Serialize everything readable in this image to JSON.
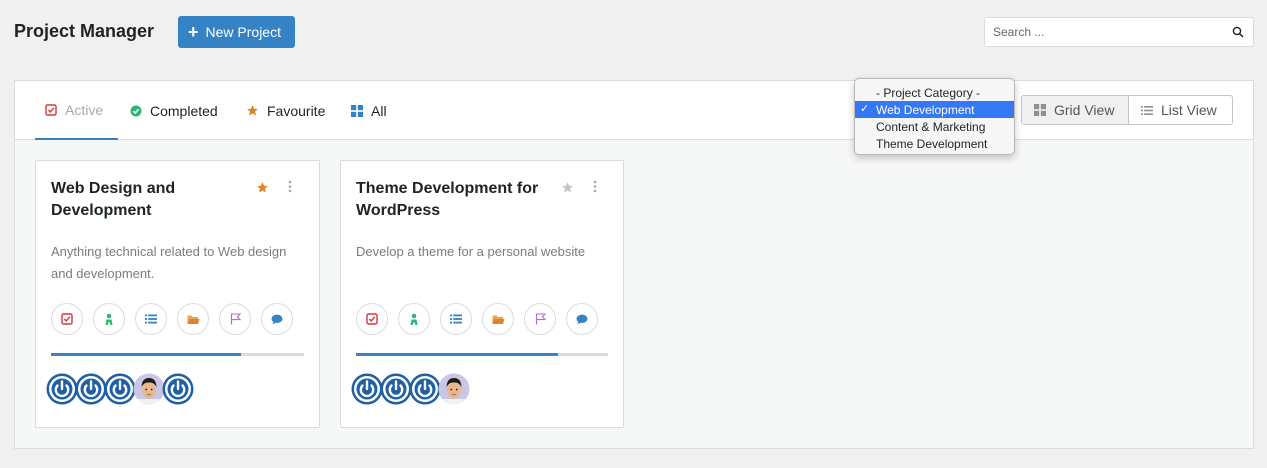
{
  "header": {
    "title": "Project Manager",
    "new_project_label": "New Project",
    "search_placeholder": "Search ..."
  },
  "tabs": [
    {
      "label": "Active",
      "icon": "active-checkbox-icon",
      "active": true
    },
    {
      "label": "Completed",
      "icon": "check-circle-icon",
      "active": false
    },
    {
      "label": "Favourite",
      "icon": "star-icon",
      "active": false
    },
    {
      "label": "All",
      "icon": "grid-icon",
      "active": false
    }
  ],
  "category_dropdown": {
    "options": [
      "- Project Category -",
      "Web Development",
      "Content & Marketing",
      "Theme Development"
    ],
    "selected": "Web Development"
  },
  "view_toggle": {
    "grid_label": "Grid View",
    "list_label": "List View",
    "selected": "grid"
  },
  "projects": [
    {
      "title": "Web Design and Development",
      "description": "Anything technical related to Web design and development.",
      "favourite": true,
      "progress": 0.75,
      "avatars": [
        "default-avatar",
        "default-avatar",
        "default-avatar",
        "photo-avatar",
        "default-avatar"
      ]
    },
    {
      "title": "Theme Development for WordPress",
      "description": "Develop a theme for a personal website",
      "favourite": false,
      "progress": 0.8,
      "avatars": [
        "default-avatar",
        "default-avatar",
        "default-avatar",
        "photo-avatar"
      ]
    }
  ],
  "card_actions": [
    "task-icon",
    "milestone-people-icon",
    "list-icon",
    "folder-icon",
    "flag-icon",
    "comment-icon"
  ],
  "colors": {
    "accent": "#3582c4",
    "favourite_star": "#e0822a",
    "star_inactive": "#c3c4c7",
    "completed_green": "#2bb673",
    "active_red": "#d63638",
    "dropdown_highlight": "#3478f6"
  }
}
